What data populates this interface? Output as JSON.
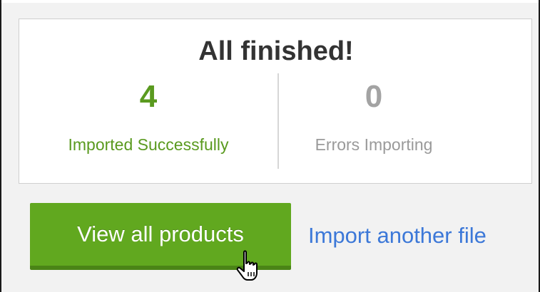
{
  "panel": {
    "title": "All finished!",
    "stats": [
      {
        "value": "4",
        "label": "Imported Successfully",
        "color": "#5a9a1f"
      },
      {
        "value": "0",
        "label": "Errors Importing",
        "color": "#a3a3a3"
      }
    ]
  },
  "actions": {
    "primary_label": "View all products",
    "primary_color": "#61a81f",
    "secondary_label": "Import another file",
    "secondary_color": "#3c78d8"
  },
  "cursor": {
    "icon": "pointer-hand-icon"
  }
}
